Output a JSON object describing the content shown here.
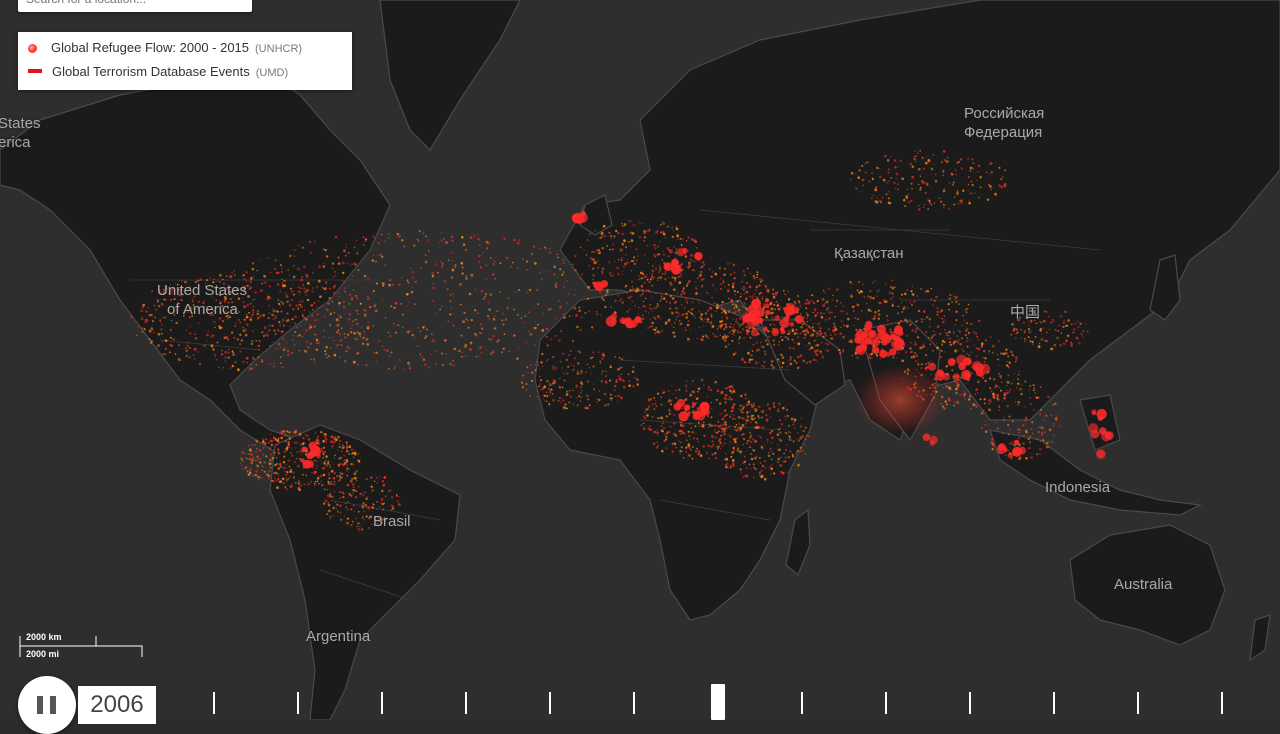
{
  "search": {
    "placeholder": "Search for a location..."
  },
  "legend": {
    "items": [
      {
        "label": "Global Refugee Flow: 2000 - 2015",
        "source": "(UNHCR)",
        "symbol": "dot",
        "color": "#ff2a2a"
      },
      {
        "label": "Global Terrorism Database Events",
        "source": "(UMD)",
        "symbol": "line",
        "color": "#e0141e"
      }
    ]
  },
  "places": {
    "usa_line1": "United States",
    "usa_line2": "of America",
    "usa_edge_line1": "States",
    "usa_edge_line2": "erica",
    "russia_line1": "Российская",
    "russia_line2": "Федерация",
    "kazakhstan": "Қазақстан",
    "china": "中国",
    "indonesia": "Indonesia",
    "australia": "Australia",
    "brasil": "Brasil",
    "argentina": "Argentina"
  },
  "scale": {
    "km": "2000 km",
    "mi": "2000 mi"
  },
  "timeline": {
    "year": "2006",
    "tick_count": 13,
    "current_index": 6
  },
  "colors": {
    "map_bg": "#2e2e2e",
    "land": "#1b1b1b",
    "border": "#4a4a4a",
    "refugee": "#ff2a2a",
    "flow": "#ff8c1a"
  }
}
